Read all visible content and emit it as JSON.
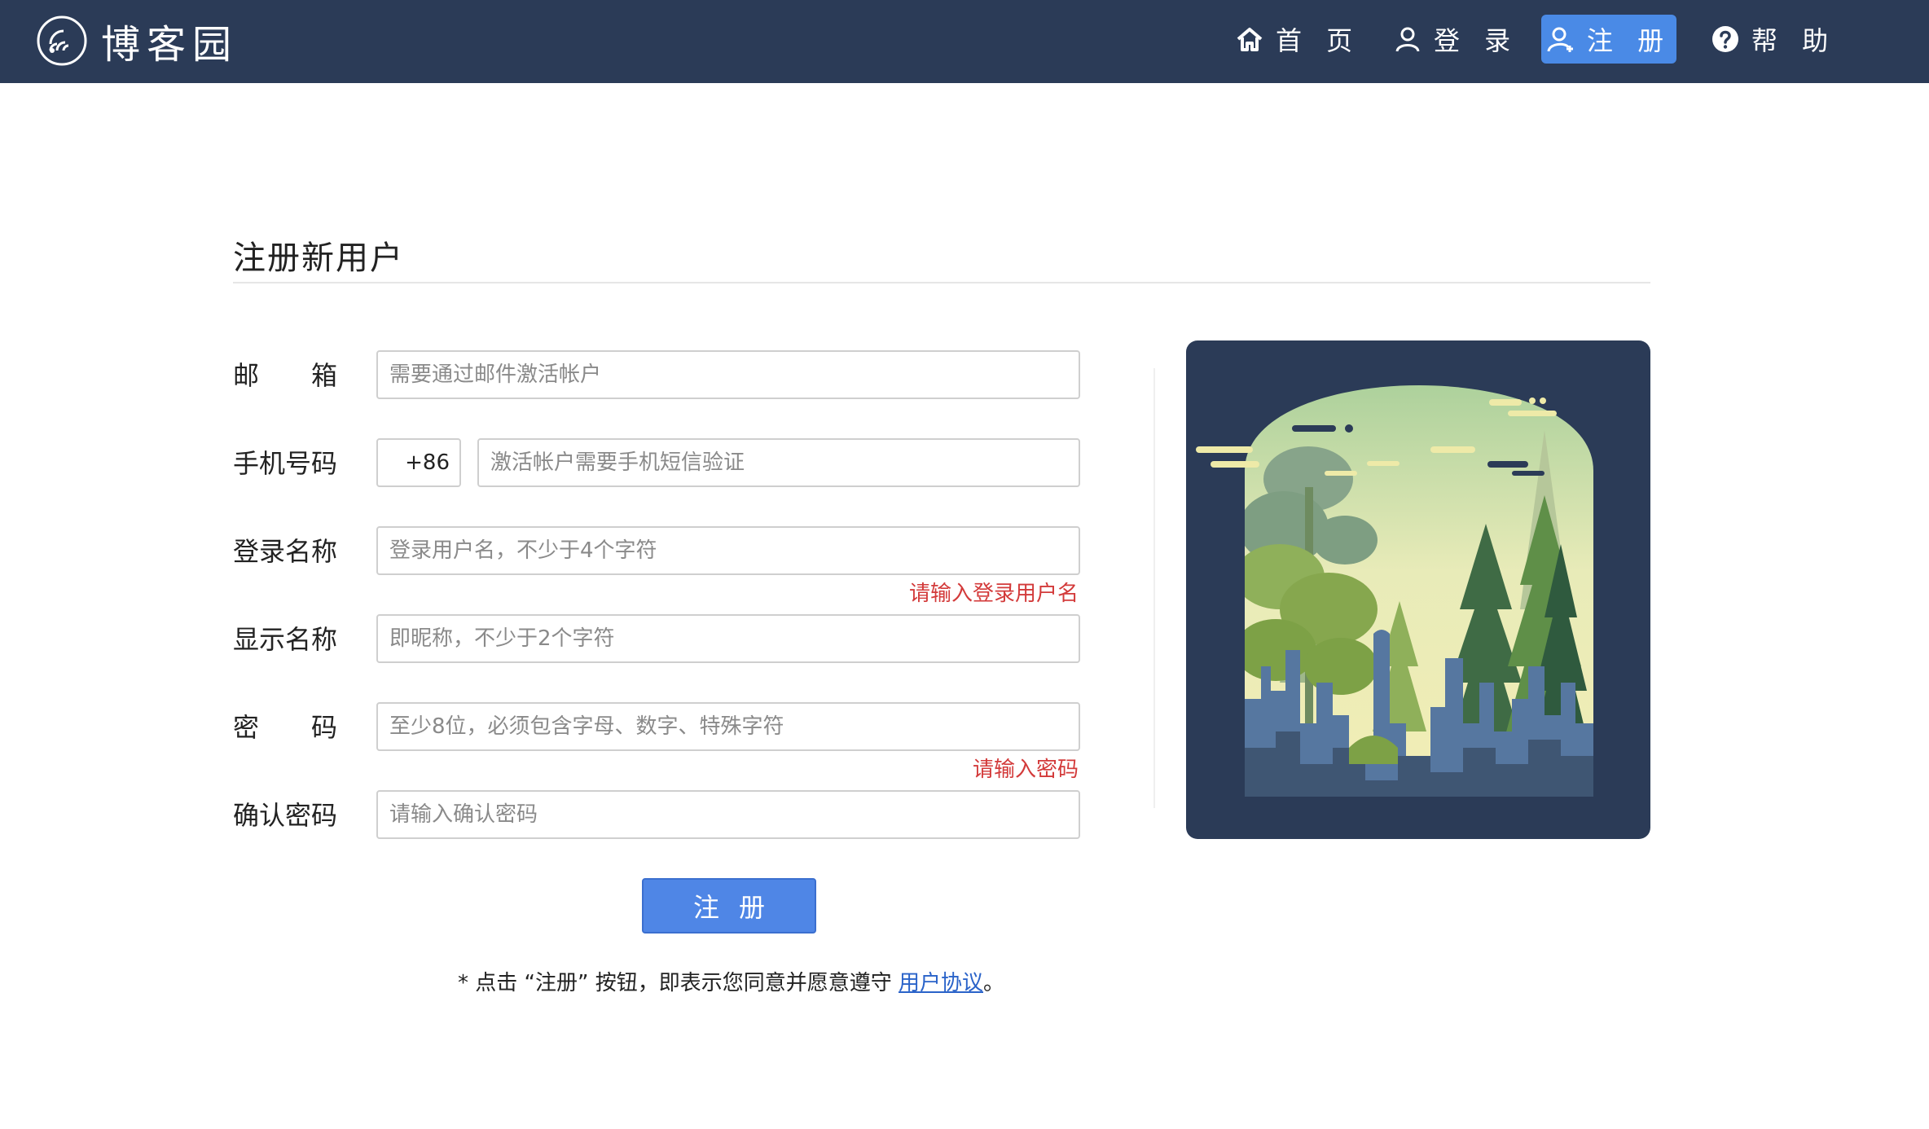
{
  "header": {
    "logo_text": "博客园",
    "nav": [
      {
        "label": "首 页"
      },
      {
        "label": "登 录"
      },
      {
        "label": "注 册"
      },
      {
        "label": "帮 助"
      }
    ]
  },
  "page_title": "注册新用户",
  "form": {
    "email": {
      "label": [
        "邮",
        "箱"
      ],
      "placeholder": "需要通过邮件激活帐户"
    },
    "phone": {
      "label": "手机号码",
      "prefix": "+86",
      "placeholder": "激活帐户需要手机短信验证"
    },
    "login_name": {
      "label": "登录名称",
      "placeholder": "登录用户名，不少于4个字符",
      "error": "请输入登录用户名"
    },
    "display_name": {
      "label": "显示名称",
      "placeholder": "即昵称，不少于2个字符"
    },
    "password": {
      "label": [
        "密",
        "码"
      ],
      "placeholder": "至少8位，必须包含字母、数字、特殊字符",
      "error": "请输入密码"
    },
    "confirm_password": {
      "label": "确认密码",
      "placeholder": "请输入确认密码"
    },
    "submit_label": "注册",
    "terms_prefix": "* 点击 “注册” 按钮，即表示您同意并愿意遵守 ",
    "terms_link": "用户协议",
    "terms_suffix": "。"
  },
  "colors": {
    "header_bg": "#2b3b57",
    "active_nav": "#4a8ae6",
    "error": "#d33a3a",
    "link": "#2a63c9"
  }
}
